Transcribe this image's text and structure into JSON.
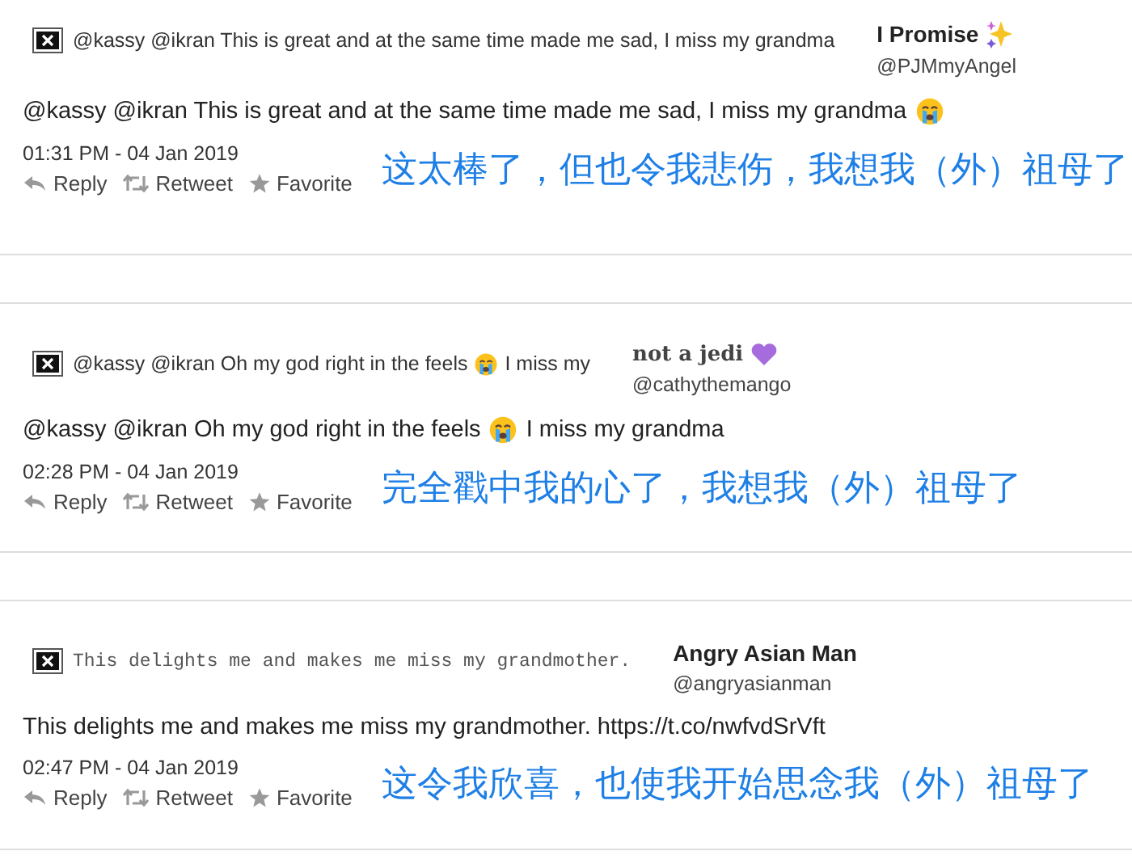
{
  "tweets": [
    {
      "embed": {
        "kind": "plain",
        "segments": [
          {
            "kind": "text",
            "text": "@kassy @ikran This is great and at the same time made me sad, I miss my grandma"
          }
        ]
      },
      "author": {
        "kind": "plain",
        "name": [
          {
            "kind": "text",
            "text": "I Promise"
          },
          {
            "kind": "sparkles"
          }
        ],
        "handle": "@PJMmyAngel"
      },
      "body": [
        {
          "kind": "text",
          "text": "@kassy @ikran This is great and at the same time made me sad, I miss my grandma"
        },
        {
          "kind": "emoji"
        }
      ],
      "time": "01:31 PM - 04 Jan 2019",
      "actions": [
        "Reply",
        "Retweet",
        "Favorite"
      ],
      "translation": "这太棒了，但也令我悲伤，我想我（外）祖母了"
    },
    {
      "embed": {
        "kind": "plain",
        "segments": [
          {
            "kind": "text",
            "text": "@kassy @ikran Oh my god right in the feels"
          },
          {
            "kind": "emoji"
          },
          {
            "kind": "text",
            "text": "I miss my"
          }
        ]
      },
      "author": {
        "kind": "fancy",
        "name": [
          {
            "kind": "text",
            "text": "not a jedi"
          },
          {
            "kind": "heart"
          }
        ],
        "handle": "@cathythemango"
      },
      "body": [
        {
          "kind": "text",
          "text": "@kassy @ikran Oh my god right in the feels"
        },
        {
          "kind": "emoji"
        },
        {
          "kind": "text",
          "text": "I miss my grandma"
        }
      ],
      "time": "02:28 PM - 04 Jan 2019",
      "actions": [
        "Reply",
        "Retweet",
        "Favorite"
      ],
      "translation": "完全戳中我的心了，我想我（外）祖母了"
    },
    {
      "embed": {
        "kind": "mono",
        "segments": [
          {
            "kind": "text",
            "text": "This delights me and makes me miss my grandmother."
          }
        ]
      },
      "author": {
        "kind": "plain",
        "name": [
          {
            "kind": "text",
            "text": "Angry Asian Man"
          }
        ],
        "handle": "@angryasianman"
      },
      "body": [
        {
          "kind": "text",
          "text": "This delights me and makes me miss my grandmother. https://t.co/nwfvdSrVft"
        }
      ],
      "time": "02:47 PM - 04 Jan 2019",
      "actions": [
        "Reply",
        "Retweet",
        "Favorite"
      ],
      "translation": "这令我欣喜，也使我开始思念我（外）祖母了"
    }
  ]
}
